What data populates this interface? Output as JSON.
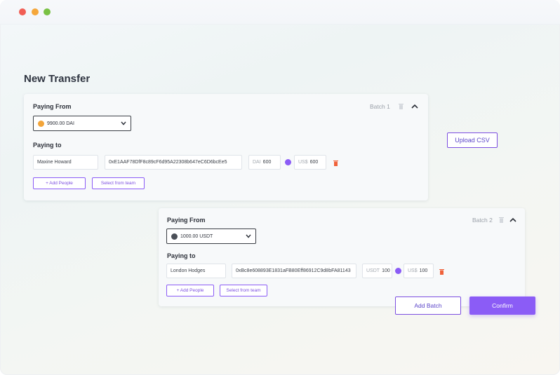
{
  "page": {
    "title": "New Transfer"
  },
  "actions": {
    "upload_csv": "Upload CSV",
    "add_batch": "Add Batch",
    "confirm": "Confirm"
  },
  "batches": [
    {
      "label": "Batch 1",
      "paying_from_label": "Paying From",
      "paying_from_value": "9900.00 DAI",
      "paying_to_label": "Paying to",
      "recipient": {
        "name": "Maxine Howard",
        "address": "0xE1AAF78DfF8c89cF6d95A22308b647eC6D6bcEe5",
        "token_unit": "DAI",
        "token_amount": "600",
        "usd_unit": "US$",
        "usd_amount": "600"
      },
      "add_people": "+ Add People",
      "select_team": "Select from team"
    },
    {
      "label": "Batch 2",
      "paying_from_label": "Paying From",
      "paying_from_value": "1000.00 USDT",
      "paying_to_label": "Paying to",
      "recipient": {
        "name": "London Hodges",
        "address": "0xBc8e608893E1831aFB80Eff86912C9d8bFA81143",
        "token_unit": "USDT",
        "token_amount": "100",
        "usd_unit": "US$",
        "usd_amount": "100"
      },
      "add_people": "+ Add People",
      "select_team": "Select from team"
    }
  ],
  "colors": {
    "accent": "#8b5cf6",
    "delete": "#f0623a",
    "dai": "#f3a53a"
  },
  "icons": [
    "trash-icon",
    "chevron-up-icon",
    "chevron-down-icon",
    "swap-icon",
    "delete-icon",
    "dai-coin-icon",
    "usdt-coin-icon"
  ]
}
